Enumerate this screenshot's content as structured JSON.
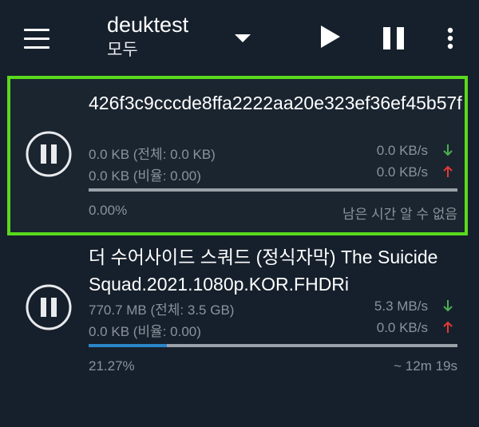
{
  "toolbar": {
    "title": "deuktest",
    "filter": "모두",
    "icons": [
      "menu-icon",
      "dropdown-arrow-icon",
      "play-icon",
      "pause-icon",
      "more-vert-icon"
    ]
  },
  "torrents": [
    {
      "name": "426f3c9cccde8ffa2222aa20e323ef36ef45b57f",
      "downloaded": "0.0 KB (전체: 0.0 KB)",
      "uploaded": "0.0 KB (비율: 0.00)",
      "down_speed": "0.0 KB/s",
      "up_speed": "0.0 KB/s",
      "progress_label": "0.00%",
      "progress": 0.0,
      "eta": "남은 시간 알 수 없음",
      "selected": true
    },
    {
      "name": "더 수어사이드 스쿼드 (정식자막) The Suicide Squad.2021.1080p.KOR.FHDRi",
      "downloaded": "770.7 MB (전체: 3.5 GB)",
      "uploaded": "0.0 KB (비율: 0.00)",
      "down_speed": "5.3 MB/s",
      "up_speed": "0.0 KB/s",
      "progress_label": "21.27%",
      "progress": 0.2127,
      "eta": "~ 12m 19s",
      "selected": false
    }
  ],
  "colors": {
    "background": "#16202c",
    "selection_border": "#5ad91d",
    "download_arrow": "#4caf50",
    "upload_arrow": "#e53935",
    "progress_fill": "#2b86c8"
  }
}
